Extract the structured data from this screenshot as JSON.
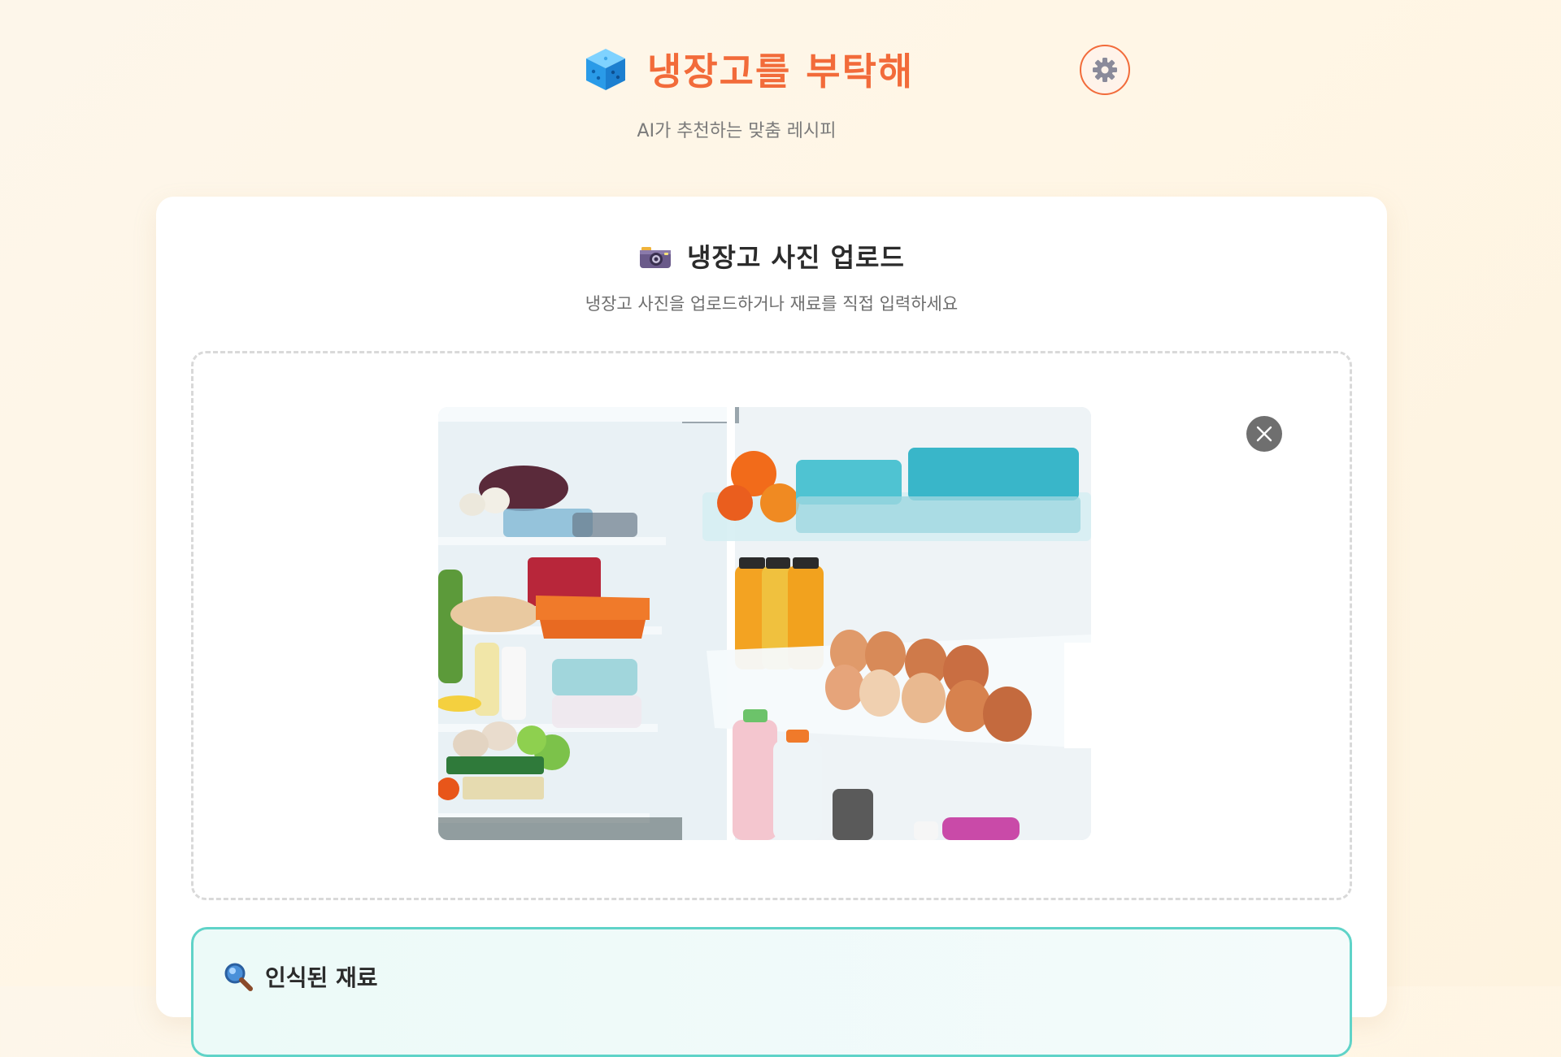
{
  "header": {
    "app_title": "냉장고를 부탁해",
    "subtitle": "AI가 추천하는 맞춤 레시피",
    "logo_icon": "ice-cube-icon",
    "settings_icon": "gear-icon"
  },
  "upload_card": {
    "title": "냉장고 사진 업로드",
    "title_icon": "camera-icon",
    "description": "냉장고 사진을 업로드하거나 재료를 직접 입력하세요",
    "photo_alt": "냉장고 사진",
    "remove_icon": "close-icon"
  },
  "recognized": {
    "title": "인식된 재료",
    "icon": "magnifier-icon"
  },
  "colors": {
    "accent": "#f26b3a",
    "teal_border": "#5fd3c8",
    "background": "#fdf6ea"
  }
}
